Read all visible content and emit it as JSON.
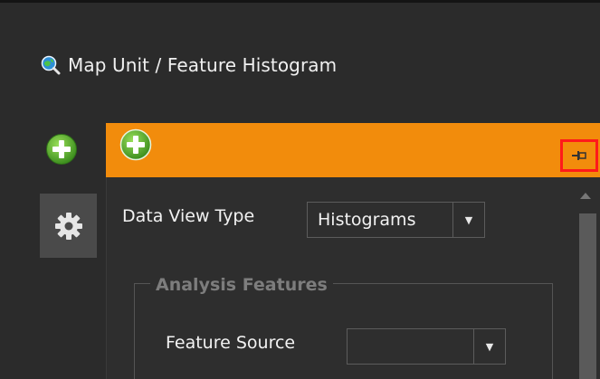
{
  "window": {
    "title": "Map Unit / Feature Histogram",
    "app_icon": "magnifier-globe-icon"
  },
  "rail": {
    "add_icon": "plus-circle-icon",
    "settings_icon": "gear-icon"
  },
  "panel": {
    "header_color": "#f28c0c",
    "add_icon": "plus-circle-icon",
    "pin_icon": "pin-icon",
    "data_view_type": {
      "label": "Data View Type",
      "selected": "Histograms"
    },
    "analysis_features": {
      "title": "Analysis Features",
      "feature_source": {
        "label": "Feature Source",
        "selected": ""
      }
    }
  },
  "colors": {
    "background": "#2b2b2b",
    "accent": "#f28c0c",
    "highlight_border": "#ff1a1a",
    "add_green": "#5db030"
  }
}
